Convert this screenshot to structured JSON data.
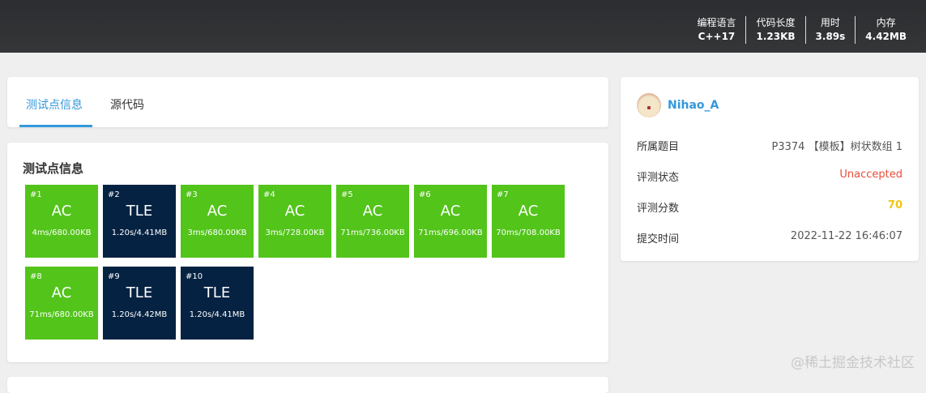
{
  "header": {
    "stats": [
      {
        "label": "编程语言",
        "value": "C++17"
      },
      {
        "label": "代码长度",
        "value": "1.23KB"
      },
      {
        "label": "用时",
        "value": "3.89s"
      },
      {
        "label": "内存",
        "value": "4.42MB"
      }
    ]
  },
  "tabs": [
    {
      "label": "测试点信息"
    },
    {
      "label": "源代码"
    }
  ],
  "cases": {
    "title": "测试点信息",
    "items": [
      {
        "id": "#1",
        "status": "AC",
        "info": "4ms/680.00KB"
      },
      {
        "id": "#2",
        "status": "TLE",
        "info": "1.20s/4.41MB"
      },
      {
        "id": "#3",
        "status": "AC",
        "info": "3ms/680.00KB"
      },
      {
        "id": "#4",
        "status": "AC",
        "info": "3ms/728.00KB"
      },
      {
        "id": "#5",
        "status": "AC",
        "info": "71ms/736.00KB"
      },
      {
        "id": "#6",
        "status": "AC",
        "info": "71ms/696.00KB"
      },
      {
        "id": "#7",
        "status": "AC",
        "info": "70ms/708.00KB"
      },
      {
        "id": "#8",
        "status": "AC",
        "info": "71ms/680.00KB"
      },
      {
        "id": "#9",
        "status": "TLE",
        "info": "1.20s/4.42MB"
      },
      {
        "id": "#10",
        "status": "TLE",
        "info": "1.20s/4.41MB"
      }
    ]
  },
  "side": {
    "username": "Nihao_A",
    "rows": [
      {
        "label": "所属题目",
        "value": "P3374 【模板】树状数组 1"
      },
      {
        "label": "评测状态",
        "value": "Unaccepted"
      },
      {
        "label": "评测分数",
        "value": "70"
      },
      {
        "label": "提交时间",
        "value": "2022-11-22 16:46:07"
      }
    ]
  },
  "watermark": "@稀土掘金技术社区"
}
